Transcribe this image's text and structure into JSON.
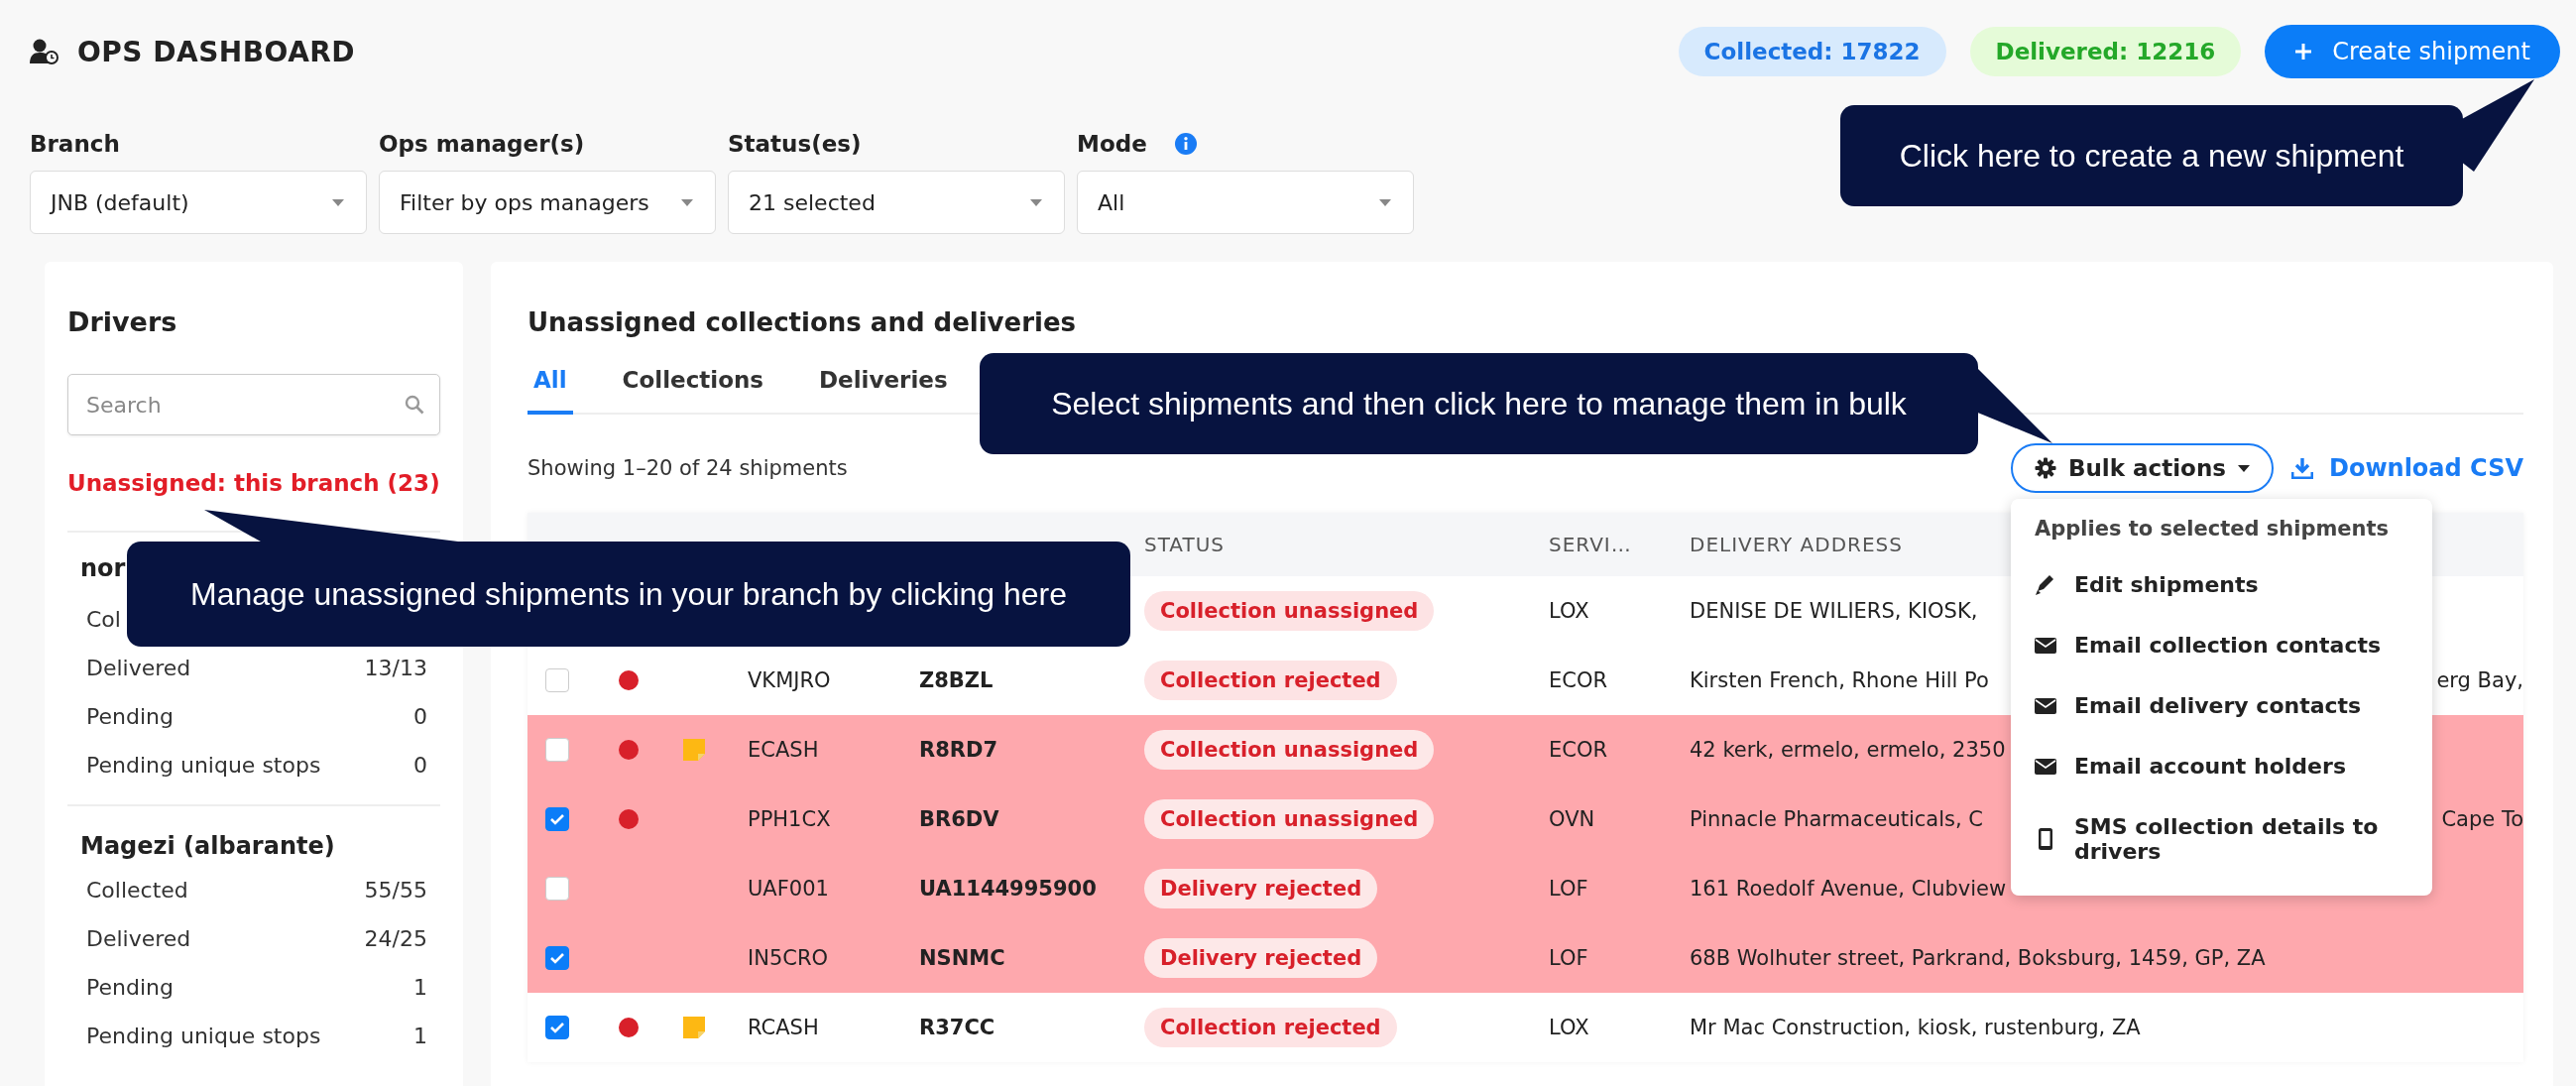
{
  "header": {
    "title": "OPS DASHBOARD",
    "badges": [
      {
        "kind": "collected",
        "text": "Collected: 17822"
      },
      {
        "kind": "delivered",
        "text": "Delivered: 12216"
      }
    ],
    "create_button": "Create shipment"
  },
  "filters": [
    {
      "label": "Branch",
      "value": "JNB (default)",
      "has_info": false
    },
    {
      "label": "Ops manager(s)",
      "value": "Filter by ops managers",
      "has_info": false
    },
    {
      "label": "Status(es)",
      "value": "21 selected",
      "has_info": false
    },
    {
      "label": "Mode",
      "value": "All",
      "has_info": true
    }
  ],
  "drivers": {
    "title": "Drivers",
    "search": {
      "placeholder": "Search"
    },
    "unassigned_link": "Unassigned: this branch (23)",
    "groups": [
      {
        "name": "nor",
        "stats": [
          {
            "label": "Col"
          },
          {
            "label": "Delivered",
            "value": "13/13"
          },
          {
            "label": "Pending",
            "value": "0"
          },
          {
            "label": "Pending unique stops",
            "value": "0"
          }
        ]
      },
      {
        "name": "Magezi (albarante)",
        "stats": [
          {
            "label": "Collected",
            "value": "55/55"
          },
          {
            "label": "Delivered",
            "value": "24/25"
          },
          {
            "label": "Pending",
            "value": "1"
          },
          {
            "label": "Pending unique stops",
            "value": "1"
          }
        ]
      }
    ]
  },
  "main": {
    "title": "Unassigned collections and deliveries",
    "tabs": [
      {
        "label": "All",
        "selected": true
      },
      {
        "label": "Collections",
        "selected": false
      },
      {
        "label": "Deliveries",
        "selected": false
      }
    ],
    "summary": "Showing 1–20 of 24 shipments",
    "bulk_button": "Bulk actions",
    "download_link": "Download CSV",
    "bulk_menu": {
      "heading": "Applies to selected shipments",
      "items": [
        {
          "kind": "edit",
          "label": "Edit shipments"
        },
        {
          "kind": "email",
          "label": "Email collection contacts"
        },
        {
          "kind": "email",
          "label": "Email delivery contacts"
        },
        {
          "kind": "email",
          "label": "Email account holders"
        },
        {
          "kind": "sms",
          "label": "SMS collection details to drivers"
        }
      ]
    },
    "table": {
      "columns": [
        "STATUS",
        "SERVI…",
        "DELIVERY ADDRESS"
      ],
      "rows": [
        {
          "highlighted": false,
          "status": "Collection unassigned",
          "service": "LOX",
          "address": [
            "DENISE DE WILIERS, KIOSK,"
          ]
        },
        {
          "highlighted": false,
          "checked": false,
          "flagged": true,
          "has_note": false,
          "account": "VKMJRO",
          "waybill": "Z8BZL",
          "status": "Collection rejected",
          "service": "ECOR",
          "address": [
            "Kirsten French, Rhone Hill Po",
            "erg Bay,"
          ]
        },
        {
          "highlighted": true,
          "checked": false,
          "flagged": true,
          "has_note": true,
          "account": "ECASH",
          "waybill": "R8RD7",
          "status": "Collection unassigned",
          "service": "ECOR",
          "address": [
            "42 kerk, ermelo, ermelo, 2350"
          ]
        },
        {
          "highlighted": true,
          "checked": true,
          "flagged": true,
          "has_note": false,
          "account": "PPH1CX",
          "waybill": "BR6DV",
          "status": "Collection unassigned",
          "service": "OVN",
          "address": [
            "Pinnacle Pharmaceuticals, C",
            "Cape To"
          ]
        },
        {
          "highlighted": true,
          "checked": false,
          "flagged": false,
          "has_note": false,
          "account": "UAF001",
          "waybill": "UA1144995900",
          "status": "Delivery rejected",
          "service": "LOF",
          "address": [
            "161 Roedolf Avenue, Clubview"
          ]
        },
        {
          "highlighted": true,
          "checked": true,
          "flagged": false,
          "has_note": false,
          "account": "IN5CRO",
          "waybill": "NSNMC",
          "status": "Delivery rejected",
          "service": "LOF",
          "address": [
            "68B Wolhuter street, Parkrand, Boksburg, 1459, GP, ZA"
          ]
        },
        {
          "highlighted": false,
          "checked": true,
          "flagged": true,
          "has_note": true,
          "account": "RCASH",
          "waybill": "R37CC",
          "status": "Collection rejected",
          "service": "LOX",
          "address": [
            "Mr Mac Construction, kiosk, rustenburg, ZA"
          ]
        }
      ]
    }
  },
  "callouts": [
    "Click here to create a new shipment",
    "Select shipments and then click here to manage them in bulk",
    "Manage unassigned shipments in your branch by clicking here"
  ]
}
